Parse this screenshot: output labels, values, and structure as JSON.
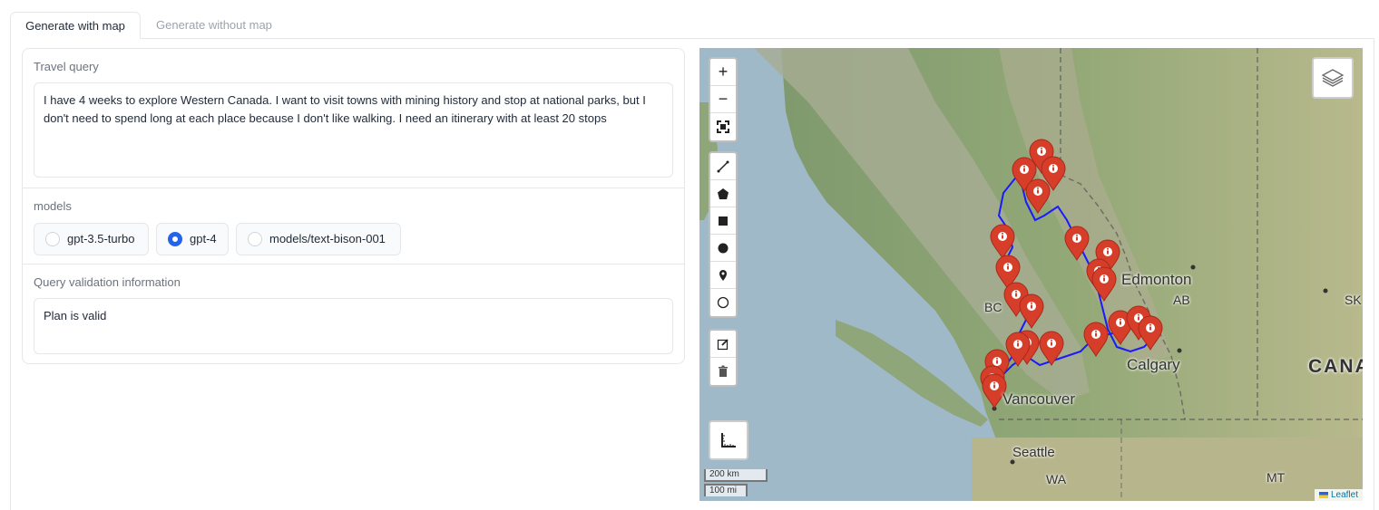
{
  "tabs": [
    {
      "label": "Generate with map",
      "active": true
    },
    {
      "label": "Generate without map",
      "active": false
    }
  ],
  "travel_query": {
    "label": "Travel query",
    "value": "I have 4 weeks to explore Western Canada. I want to visit towns with mining history and stop at national parks, but I don't need to spend long at each place because I don't like walking. I need an itinerary with at least 20 stops"
  },
  "models": {
    "label": "models",
    "options": [
      "gpt-3.5-turbo",
      "gpt-4",
      "models/text-bison-001"
    ],
    "selected": "gpt-4"
  },
  "validation": {
    "label": "Query validation information",
    "value": "Plan is valid"
  },
  "map": {
    "zoom_in": "+",
    "zoom_out": "−",
    "labels": {
      "edmonton": "Edmonton",
      "ab": "AB",
      "sk": "SK",
      "bc": "BC",
      "calgary": "Calgary",
      "canada": "CANA",
      "vancouver": "Vancouver",
      "seattle": "Seattle",
      "wa": "WA",
      "mt": "MT"
    },
    "scale_km": "200 km",
    "scale_mi": "100 mi",
    "attribution": "Leaflet",
    "colors": {
      "route": "#1a1aff",
      "marker": "#d63e2a",
      "water": "#9fb9c8",
      "land": "#8fa67a"
    }
  }
}
